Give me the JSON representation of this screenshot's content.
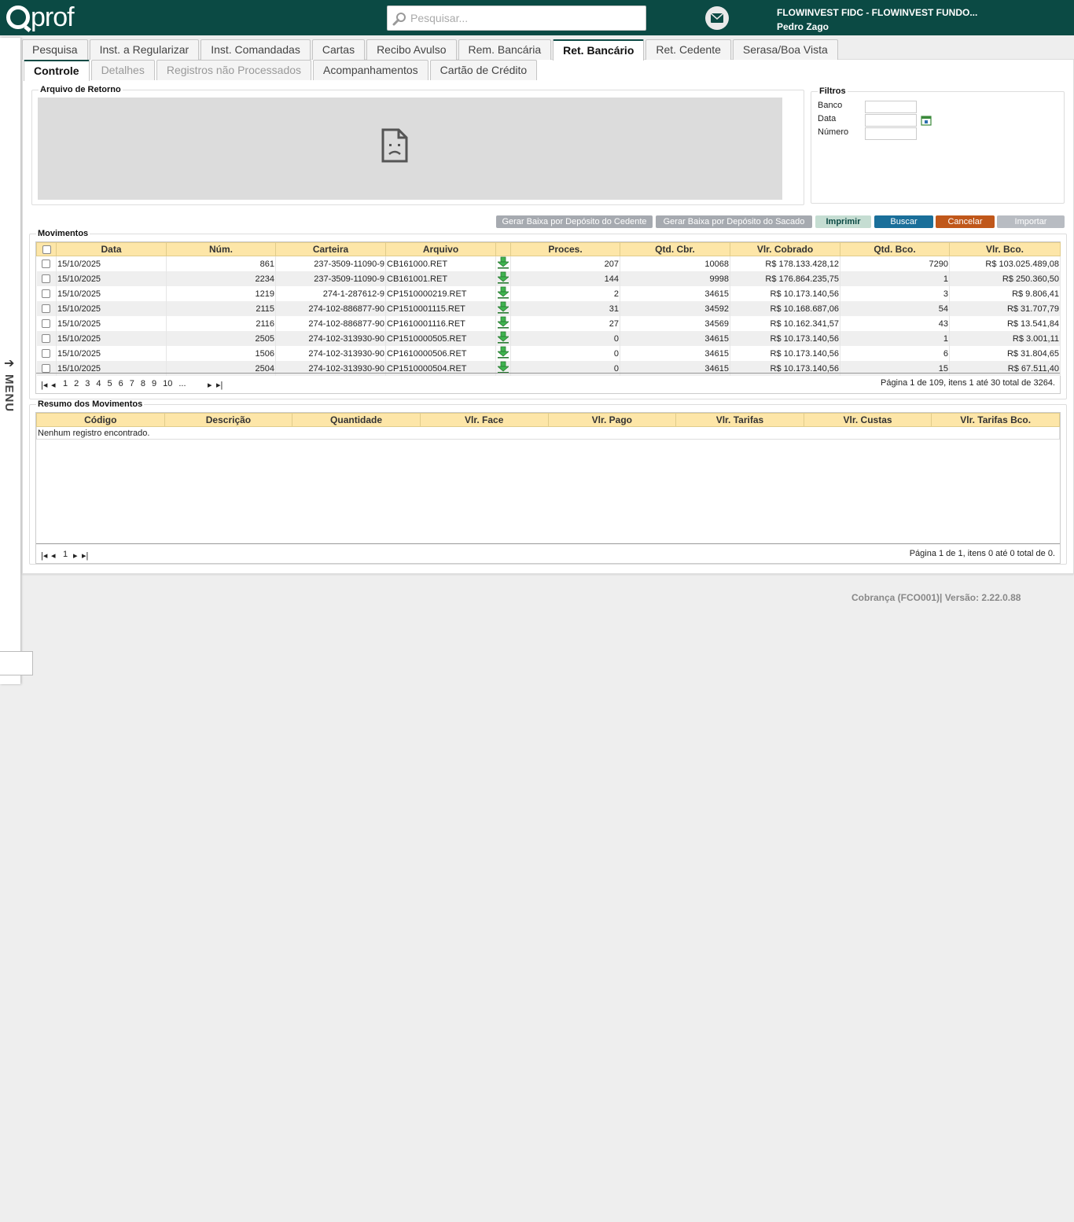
{
  "header": {
    "logo": "Qprof",
    "search_placeholder": "Pesquisar...",
    "company": "FLOWINVEST FIDC - FLOWINVEST FUNDO...",
    "user": "Pedro Zago"
  },
  "sidebar": {
    "menu_label": "MENU"
  },
  "tabs_main": [
    "Pesquisa",
    "Inst. a Regularizar",
    "Inst. Comandadas",
    "Cartas",
    "Recibo Avulso",
    "Rem. Bancária",
    "Ret. Bancário",
    "Ret. Cedente",
    "Serasa/Boa Vista"
  ],
  "tabs_sub": [
    "Controle",
    "Detalhes",
    "Registros não Processados",
    "Acompanhamentos",
    "Cartão de Crédito"
  ],
  "arquivo": {
    "legend": "Arquivo de Retorno"
  },
  "filtros": {
    "legend": "Filtros",
    "banco_label": "Banco",
    "data_label": "Data",
    "numero_label": "Número"
  },
  "buttons": {
    "gerar_cedente": "Gerar Baixa por Depósito do Cedente",
    "gerar_sacado": "Gerar Baixa por Depósito do Sacado",
    "imprimir": "Imprimir",
    "buscar": "Buscar",
    "cancelar": "Cancelar",
    "importar": "Importar"
  },
  "movimentos": {
    "legend": "Movimentos",
    "columns": [
      "Data",
      "Núm.",
      "Carteira",
      "Arquivo",
      "",
      "Proces.",
      "Qtd. Cbr.",
      "Vlr. Cobrado",
      "Qtd. Bco.",
      "Vlr. Bco."
    ],
    "rows": [
      [
        "15/10/2025",
        "861",
        "237-3509-11090-9",
        "CB161000.RET",
        "207",
        "10068",
        "R$ 178.133.428,12",
        "7290",
        "R$ 103.025.489,08"
      ],
      [
        "15/10/2025",
        "2234",
        "237-3509-11090-9",
        "CB161001.RET",
        "144",
        "9998",
        "R$ 176.864.235,75",
        "1",
        "R$ 250.360,50"
      ],
      [
        "15/10/2025",
        "1219",
        "274-1-287612-9",
        "CP1510000219.RET",
        "2",
        "34615",
        "R$ 10.173.140,56",
        "3",
        "R$ 9.806,41"
      ],
      [
        "15/10/2025",
        "2115",
        "274-102-886877-90",
        "CP1510001115.RET",
        "31",
        "34592",
        "R$ 10.168.687,06",
        "54",
        "R$ 31.707,79"
      ],
      [
        "15/10/2025",
        "2116",
        "274-102-886877-90",
        "CP1610001116.RET",
        "27",
        "34569",
        "R$ 10.162.341,57",
        "43",
        "R$ 13.541,84"
      ],
      [
        "15/10/2025",
        "2505",
        "274-102-313930-90",
        "CP1510000505.RET",
        "0",
        "34615",
        "R$ 10.173.140,56",
        "1",
        "R$ 3.001,11"
      ],
      [
        "15/10/2025",
        "1506",
        "274-102-313930-90",
        "CP1610000506.RET",
        "0",
        "34615",
        "R$ 10.173.140,56",
        "6",
        "R$ 31.804,65"
      ],
      [
        "15/10/2025",
        "2504",
        "274-102-313930-90",
        "CP1510000504.RET",
        "0",
        "34615",
        "R$ 10.173.140,56",
        "15",
        "R$ 67.511,40"
      ]
    ],
    "pages": [
      "1",
      "2",
      "3",
      "4",
      "5",
      "6",
      "7",
      "8",
      "9",
      "10",
      "..."
    ],
    "page_info": "Página 1 de 109, itens 1 até 30 total de 3264."
  },
  "resumo": {
    "legend": "Resumo dos Movimentos",
    "columns": [
      "Código",
      "Descrição",
      "Quantidade",
      "Vlr. Face",
      "Vlr. Pago",
      "Vlr. Tarifas",
      "Vlr. Custas",
      "Vlr. Tarifas Bco."
    ],
    "empty": "Nenhum registro encontrado.",
    "page": "1",
    "page_info": "Página 1 de 1, itens 0 até 0 total de 0."
  },
  "footer": {
    "version": "Cobrança (FCO001)| Versão: 2.22.0.88"
  },
  "colors": {
    "header_bg": "#0b4a44",
    "btn_buscar": "#1a6f9a",
    "btn_cancelar": "#c0571a",
    "btn_gray": "#a6aab0",
    "btn_imprimir": "#c5ddd2",
    "table_header": "#fde6a8"
  }
}
